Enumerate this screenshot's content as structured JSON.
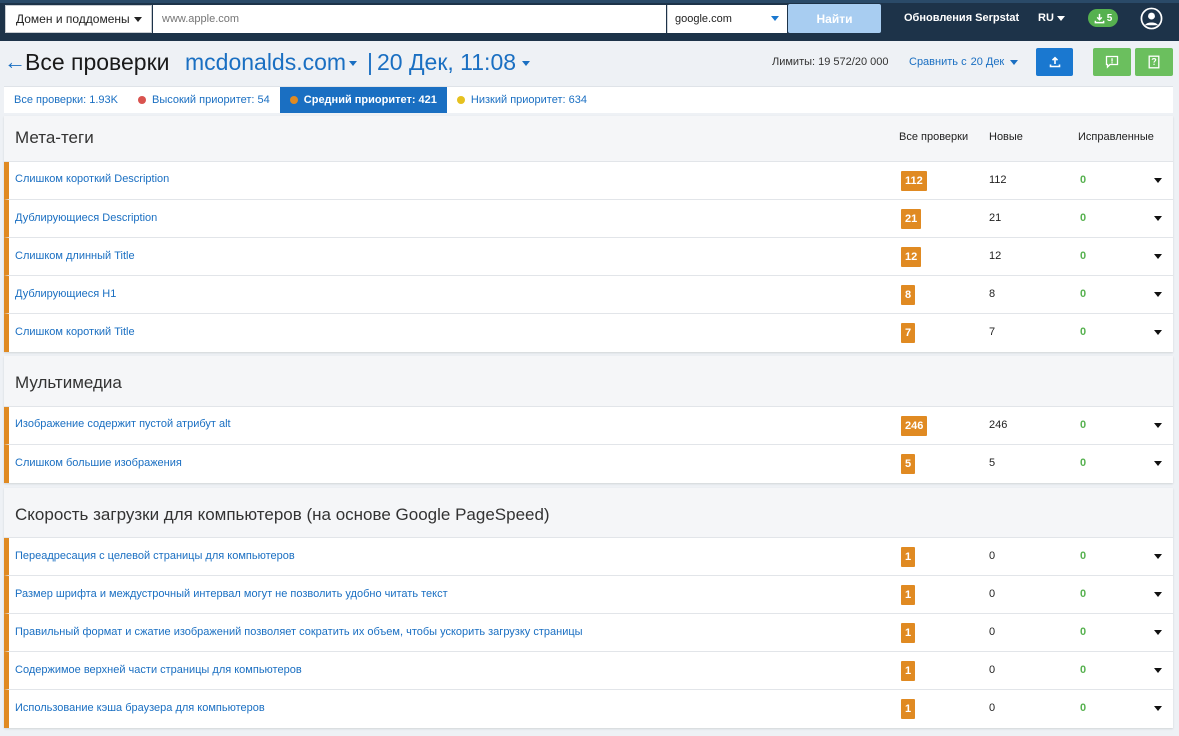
{
  "topbar": {
    "domain_select": "Домен и поддомены",
    "url_placeholder": "www.apple.com",
    "engine": "google.com",
    "find_label": "Найти",
    "updates_label": "Обновления Serpstat",
    "lang": "RU",
    "downloads_count": "5"
  },
  "header": {
    "title": "Все проверки",
    "project": "mcdonalds.com",
    "separator": "|",
    "date": "20 Дек, 11:08",
    "limits": "Лимиты: 19 572/20 000",
    "compare_label": "Сравнить с",
    "compare_date": "20 Дек"
  },
  "tabs": [
    {
      "label": "Все проверки: 1.93K"
    },
    {
      "label": "Высокий приоритет: 54",
      "dot": "#d9534f"
    },
    {
      "label": "Средний приоритет: 421",
      "dot": "#e08a22"
    },
    {
      "label": "Низкий приоритет: 634",
      "dot": "#e6c11f"
    }
  ],
  "columns": {
    "all": "Все проверки",
    "new": "Новые",
    "fixed": "Исправленные"
  },
  "sections": [
    {
      "title": "Мета-теги",
      "rows": [
        {
          "name": "Слишком короткий Description",
          "all": "112",
          "new": "112",
          "fixed": "0"
        },
        {
          "name": "Дублирующиеся Description",
          "all": "21",
          "new": "21",
          "fixed": "0"
        },
        {
          "name": "Слишком длинный Title",
          "all": "12",
          "new": "12",
          "fixed": "0"
        },
        {
          "name": "Дублирующиеся H1",
          "all": "8",
          "new": "8",
          "fixed": "0"
        },
        {
          "name": "Слишком короткий Title",
          "all": "7",
          "new": "7",
          "fixed": "0"
        }
      ]
    },
    {
      "title": "Мультимедиа",
      "rows": [
        {
          "name": "Изображение содержит пустой атрибут alt",
          "all": "246",
          "new": "246",
          "fixed": "0"
        },
        {
          "name": "Слишком большие изображения",
          "all": "5",
          "new": "5",
          "fixed": "0"
        }
      ]
    },
    {
      "title": "Скорость загрузки для компьютеров (на основе Google PageSpeed)",
      "rows": [
        {
          "name": "Переадресация с целевой страницы для компьютеров",
          "all": "1",
          "new": "0",
          "fixed": "0"
        },
        {
          "name": "Размер шрифта и междустрочный интервал могут не позволить удобно читать текст",
          "all": "1",
          "new": "0",
          "fixed": "0"
        },
        {
          "name": "Правильный формат и сжатие изображений позволяет сократить их объем, чтобы ускорить загрузку страницы",
          "all": "1",
          "new": "0",
          "fixed": "0"
        },
        {
          "name": "Содержимое верхней части страницы для компьютеров",
          "all": "1",
          "new": "0",
          "fixed": "0"
        },
        {
          "name": "Использование кэша браузера для компьютеров",
          "all": "1",
          "new": "0",
          "fixed": "0"
        }
      ]
    }
  ],
  "colors": {
    "accent": "#1a6fc2",
    "priority_medium": "#e08a22",
    "fixed_green": "#56b14f",
    "topbar": "#1d3349"
  }
}
